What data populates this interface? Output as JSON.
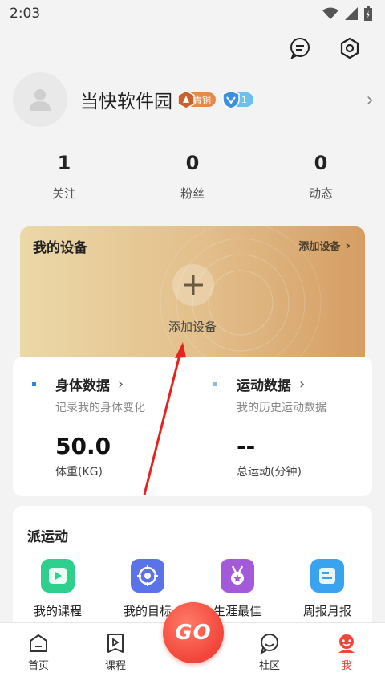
{
  "status_bar": {
    "time": "2:03"
  },
  "profile": {
    "username": "当快软件园",
    "level_badge": "青铜",
    "vip_badge": "1"
  },
  "stats": [
    {
      "value": "1",
      "label": "关注"
    },
    {
      "value": "0",
      "label": "粉丝"
    },
    {
      "value": "0",
      "label": "动态"
    }
  ],
  "device_card": {
    "title": "我的设备",
    "add_link": "添加设备",
    "add_label": "添加设备"
  },
  "body_data": {
    "title": "身体数据",
    "subtitle": "记录我的身体变化",
    "value": "50.0",
    "unit": "体重(KG)"
  },
  "sport_data": {
    "title": "运动数据",
    "subtitle": "我的历史运动数据",
    "value": "--",
    "unit": "总运动(分钟)"
  },
  "sport_section": {
    "title": "派运动",
    "items": [
      {
        "label": "我的课程",
        "icon": "course-icon",
        "color": "#2fcf8e"
      },
      {
        "label": "我的目标",
        "icon": "target-icon",
        "color": "#5b73e8"
      },
      {
        "label": "生涯最佳",
        "icon": "medal-icon",
        "color": "#a25ad9"
      },
      {
        "label": "周报月报",
        "icon": "report-icon",
        "color": "#3aa3f0"
      }
    ]
  },
  "bottom_nav": {
    "items": [
      {
        "label": "首页",
        "icon": "home-icon"
      },
      {
        "label": "课程",
        "icon": "course-play-icon"
      },
      {
        "label": "社区",
        "icon": "community-icon"
      },
      {
        "label": "我",
        "icon": "me-icon"
      }
    ],
    "go_label": "GO",
    "active": "我"
  },
  "colors": {
    "accent": "#f0453a",
    "device_card_start": "#ecd8a8",
    "device_card_end": "#d59d64",
    "annotation_arrow": "#e8231f"
  }
}
